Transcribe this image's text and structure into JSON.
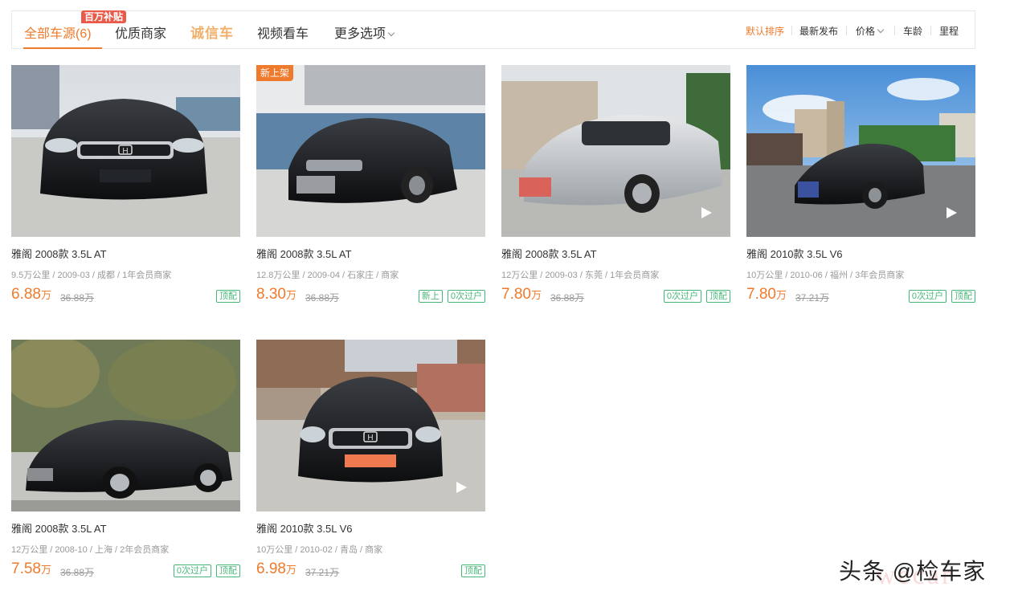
{
  "filter_bar": {
    "tabs": [
      {
        "label": "全部车源(6)"
      },
      {
        "label": "优质商家"
      },
      {
        "label": "诚信车"
      },
      {
        "label": "视频看车"
      },
      {
        "label": "更多选项"
      }
    ],
    "subsidy_badge": "百万补贴",
    "sorts": [
      {
        "label": "默认排序"
      },
      {
        "label": "最新发布"
      },
      {
        "label": "价格"
      },
      {
        "label": "车龄"
      },
      {
        "label": "里程"
      }
    ]
  },
  "cars": [
    {
      "title": "雅阁 2008款 3.5L AT",
      "meta": "9.5万公里 / 2009-03 / 成都 / 1年会员商家",
      "price": "6.88",
      "unit": "万",
      "old_price": "36.88万",
      "tags": [
        "顶配"
      ],
      "new_label": "",
      "has_video": false
    },
    {
      "title": "雅阁 2008款 3.5L AT",
      "meta": "12.8万公里 / 2009-04 / 石家庄 / 商家",
      "price": "8.30",
      "unit": "万",
      "old_price": "36.88万",
      "tags": [
        "新上",
        "0次过户"
      ],
      "new_label": "新上架",
      "has_video": false
    },
    {
      "title": "雅阁 2008款 3.5L AT",
      "meta": "12万公里 / 2009-03 / 东莞 / 1年会员商家",
      "price": "7.80",
      "unit": "万",
      "old_price": "36.88万",
      "tags": [
        "0次过户",
        "顶配"
      ],
      "new_label": "",
      "has_video": true
    },
    {
      "title": "雅阁 2010款 3.5L V6",
      "meta": "10万公里 / 2010-06 / 福州 / 3年会员商家",
      "price": "7.80",
      "unit": "万",
      "old_price": "37.21万",
      "tags": [
        "0次过户",
        "顶配"
      ],
      "new_label": "",
      "has_video": true
    },
    {
      "title": "雅阁 2008款 3.5L AT",
      "meta": "12万公里 / 2008-10 / 上海 / 2年会员商家",
      "price": "7.58",
      "unit": "万",
      "old_price": "36.88万",
      "tags": [
        "0次过户",
        "顶配"
      ],
      "new_label": "",
      "has_video": false
    },
    {
      "title": "雅阁 2010款 3.5L V6",
      "meta": "10万公里 / 2010-02 / 青岛 / 商家",
      "price": "6.98",
      "unit": "万",
      "old_price": "37.21万",
      "tags": [
        "顶配"
      ],
      "new_label": "",
      "has_video": true
    }
  ],
  "watermark": {
    "text": "头条 @检车家",
    "logo": "wecar"
  },
  "colors": {
    "accent": "#f07a2b",
    "tag_green": "#47b778",
    "badge_red": "#e95a4a"
  },
  "icons": [
    "chevron-down-icon",
    "play-icon",
    "honda-logo-icon"
  ]
}
